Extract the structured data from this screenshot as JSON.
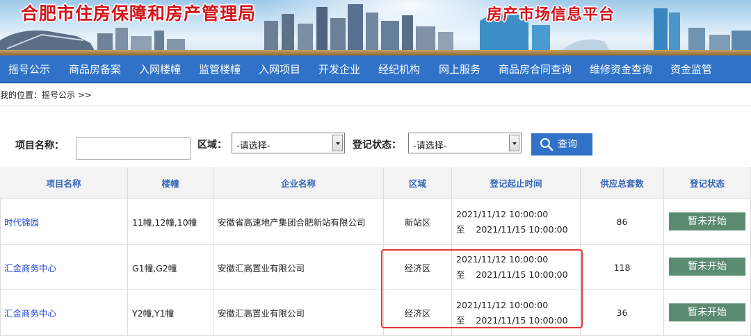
{
  "header": {
    "title_left": "合肥市住房保障和房产管理局",
    "title_right": "房产市场信息平台",
    "brand_color": "#d4141b"
  },
  "nav": {
    "items": [
      "摇号公示",
      "商品房备案",
      "入网楼幢",
      "监管楼幢",
      "入网项目",
      "开发企业",
      "经纪机构",
      "网上服务",
      "商品房合同查询",
      "维修资金查询",
      "资金监管"
    ],
    "background_color": "#2f72c8"
  },
  "breadcrumb": "我的位置：摇号公示 >>",
  "search": {
    "project_name_label": "项目名称：",
    "project_name_value": "",
    "region_label": "区域：",
    "region_selected": "-请选择-",
    "status_label": "登记状态：",
    "status_selected": "-请选择-",
    "query_button": "查询",
    "query_icon": "magnifier-icon"
  },
  "table": {
    "headers": [
      "项目名称",
      "楼幢",
      "企业名称",
      "区域",
      "登记起止时间",
      "供应总套数",
      "登记状态"
    ],
    "rows": [
      {
        "project": "时代锦园",
        "buildings": "11幢,12幢,10幢",
        "company": "安徽省高速地产集团合肥新站有限公司",
        "region": "新站区",
        "time_start": "2021/11/12 10:00:00",
        "time_end": "至    2021/11/15 10:00:00",
        "supply": "86",
        "status": "暂未开始"
      },
      {
        "project": "汇金商务中心",
        "buildings": "G1幢,G2幢",
        "company": "安徽汇高置业有限公司",
        "region": "经济区",
        "time_start": "2021/11/12 10:00:00",
        "time_end": "至    2021/11/15 10:00:00",
        "supply": "118",
        "status": "暂未开始"
      },
      {
        "project": "汇金商务中心",
        "buildings": "Y2幢,Y1幢",
        "company": "安徽汇高置业有限公司",
        "region": "经济区",
        "time_start": "2021/11/12 10:00:00",
        "time_end": "至    2021/11/15 10:00:00",
        "supply": "36",
        "status": "暂未开始"
      }
    ],
    "status_button_color": "#5b8c72",
    "header_text_color": "#3566b8",
    "link_color": "#1a3fd6"
  },
  "annotation": {
    "highlight_color": "#e8343a"
  }
}
